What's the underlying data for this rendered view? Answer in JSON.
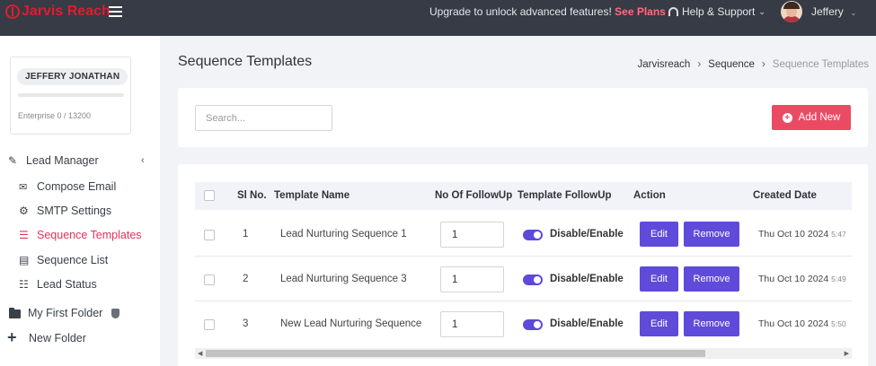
{
  "topbar": {
    "logo_text": "Jarvis Reach",
    "upgrade_text": "Upgrade to unlock advanced features!",
    "upgrade_link": "See Plans",
    "support_label": "Help & Support",
    "user_name": "Jeffery"
  },
  "profile": {
    "name": "JEFFERY JONATHAN",
    "plan": "Enterprise 0 / 13200"
  },
  "sidebar": {
    "items": [
      {
        "label": "Lead Manager"
      },
      {
        "label": "Compose Email"
      },
      {
        "label": "SMTP Settings"
      },
      {
        "label": "Sequence Templates"
      },
      {
        "label": "Sequence List"
      },
      {
        "label": "Lead Status"
      },
      {
        "label": "My First Folder"
      },
      {
        "label": "New Folder"
      }
    ]
  },
  "page": {
    "title": "Sequence Templates",
    "breadcrumb": [
      "Jarvisreach",
      "Sequence",
      "Sequence Templates"
    ]
  },
  "search": {
    "placeholder": "Search..."
  },
  "add_button": {
    "label": "Add New"
  },
  "table": {
    "headers": [
      "Sl No.",
      "Template Name",
      "No Of FollowUp",
      "Template FollowUp",
      "Action",
      "Created Date"
    ],
    "rows": [
      {
        "sl": "1",
        "name": "Lead Nurturing Sequence 1",
        "followups": "1",
        "toggle_label": "Disable/Enable",
        "edit": "Edit",
        "remove": "Remove",
        "date": "Thu Oct 10 2024",
        "time": "5:47"
      },
      {
        "sl": "2",
        "name": "Lead Nurturing Sequence 3",
        "followups": "1",
        "toggle_label": "Disable/Enable",
        "edit": "Edit",
        "remove": "Remove",
        "date": "Thu Oct 10 2024",
        "time": "5:49"
      },
      {
        "sl": "3",
        "name": "New Lead Nurturing Sequence",
        "followups": "1",
        "toggle_label": "Disable/Enable",
        "edit": "Edit",
        "remove": "Remove",
        "date": "Thu Oct 10 2024",
        "time": "5:50"
      }
    ]
  },
  "colors": {
    "topbar_bg": "#363b45",
    "brand_red": "#e21b2f",
    "accent_pink": "#ea4a63",
    "active_nav": "#e0345d",
    "action_purple": "#5f4bd9"
  },
  "icons": {
    "menu": "hamburger-icon",
    "support": "headset-icon",
    "lead_manager": "edit-icon",
    "compose": "envelope-icon",
    "smtp": "gear-icon",
    "templates": "list-icon",
    "sequence_list": "table-icon",
    "lead_status": "checklist-icon",
    "folder": "folder-icon",
    "shield": "shield-icon",
    "new_folder": "plus-icon"
  }
}
